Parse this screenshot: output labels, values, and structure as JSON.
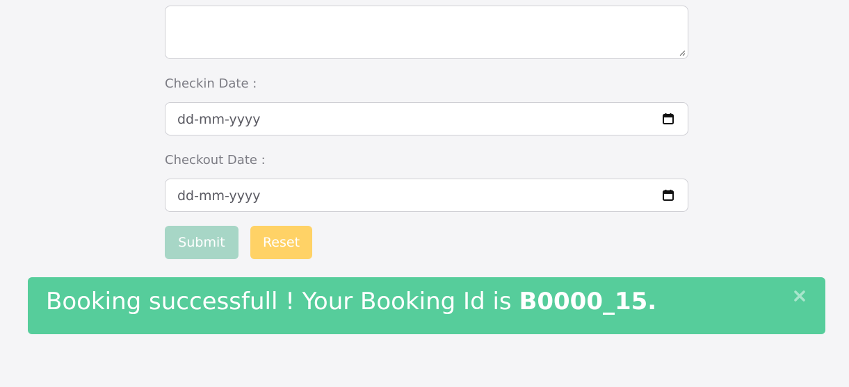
{
  "form": {
    "address_value": "",
    "checkin_label": "Checkin Date :",
    "checkin_placeholder": "dd-mm-yyyy",
    "checkout_label": "Checkout Date :",
    "checkout_placeholder": "dd-mm-yyyy",
    "submit_label": "Submit",
    "reset_label": "Reset"
  },
  "alert": {
    "message": "Booking successfull ! Your Booking Id is ",
    "booking_id": "B0000_15.",
    "close_icon": "close-icon"
  },
  "colors": {
    "background": "#f5f5f7",
    "alert_bg": "#56cd9b",
    "submit_bg": "#a7d6c6",
    "reset_bg": "#ffd266"
  },
  "icons": {
    "date_picker": "calendar-icon",
    "resize": "resize-handle-icon"
  }
}
